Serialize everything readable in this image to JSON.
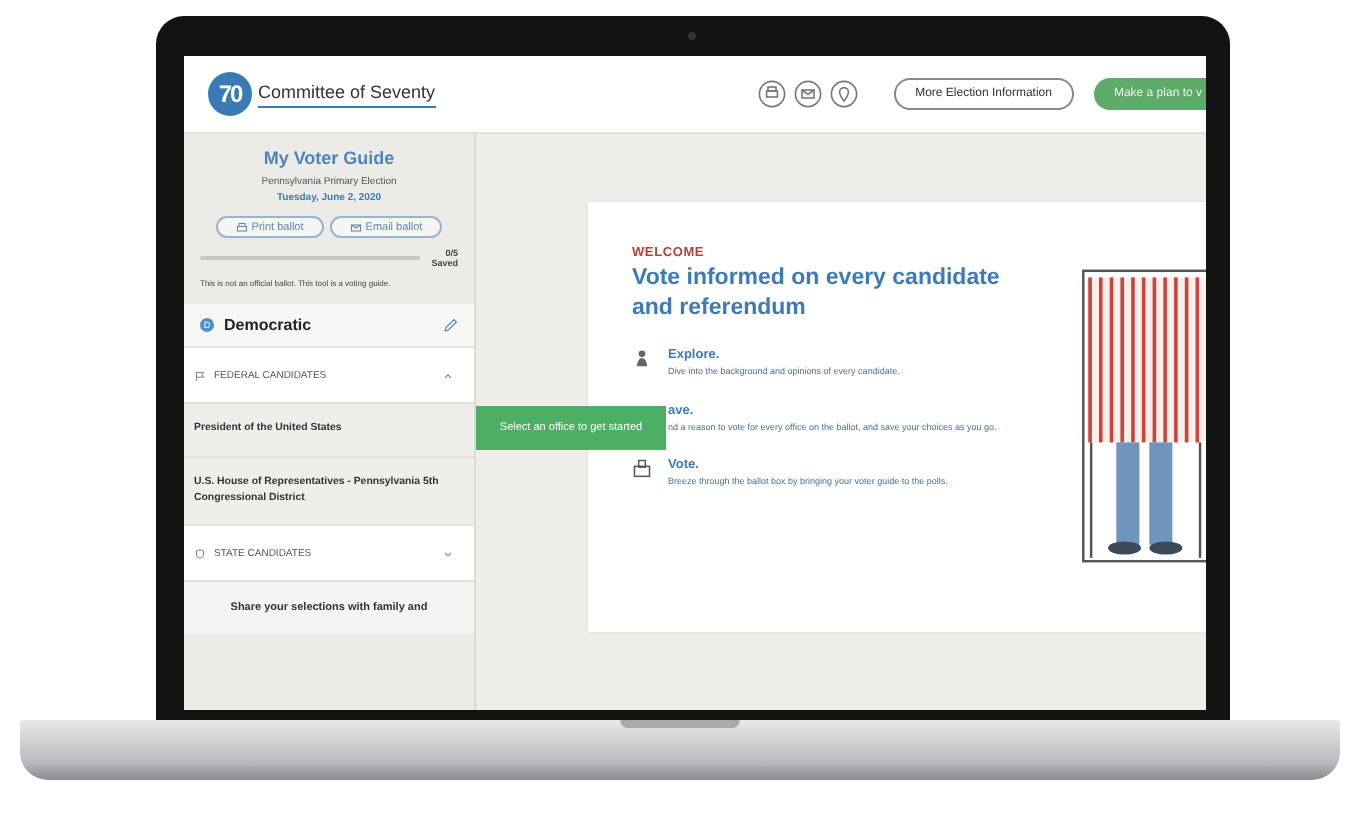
{
  "header": {
    "logo_mark": "70",
    "org_name": "Committee of Seventy",
    "buttons": [
      {
        "label": "More Election Information",
        "kind": "outline"
      },
      {
        "label": "Make a plan to v",
        "kind": "primary"
      }
    ]
  },
  "sidebar": {
    "title": "My Voter Guide",
    "election": "Pennsylvania Primary Election",
    "date": "Tuesday, June 2, 2020",
    "actions": [
      {
        "label": "Print ballot",
        "kind": "print"
      },
      {
        "label": "Email ballot",
        "kind": "email"
      }
    ],
    "progress": {
      "level": 0,
      "count": "0/5",
      "caption": "Saved"
    },
    "disclaimer": "This is not an official ballot. This tool is a voting guide.",
    "party": {
      "badge": "D",
      "name": "Democratic"
    },
    "sections": [
      {
        "title": "FEDERAL CANDIDATES",
        "kind": "federal",
        "expanded": true,
        "items": [
          "President of the United States",
          "U.S. House of Representatives - Pennsylvania 5th Congressional District"
        ]
      },
      {
        "title": "STATE CANDIDATES",
        "kind": "state",
        "expanded": false
      }
    ],
    "share": "Share your selections with family and"
  },
  "tooltip": "Select an office to get started",
  "welcome": {
    "eyebrow": "WELCOME",
    "headline": "Vote informed on every candidate and referendum",
    "steps": [
      {
        "kind": "explore",
        "title": "Explore.",
        "text": "Dive into the background and opinions of every candidate."
      },
      {
        "kind": "save",
        "title": "ave.",
        "text": "nd a reason to vote for every office on the ballot, and save your choices as you go."
      },
      {
        "kind": "vote",
        "title": "Vote.",
        "text": "Breeze through the ballot box by bringing your voter guide to the polls."
      }
    ]
  }
}
